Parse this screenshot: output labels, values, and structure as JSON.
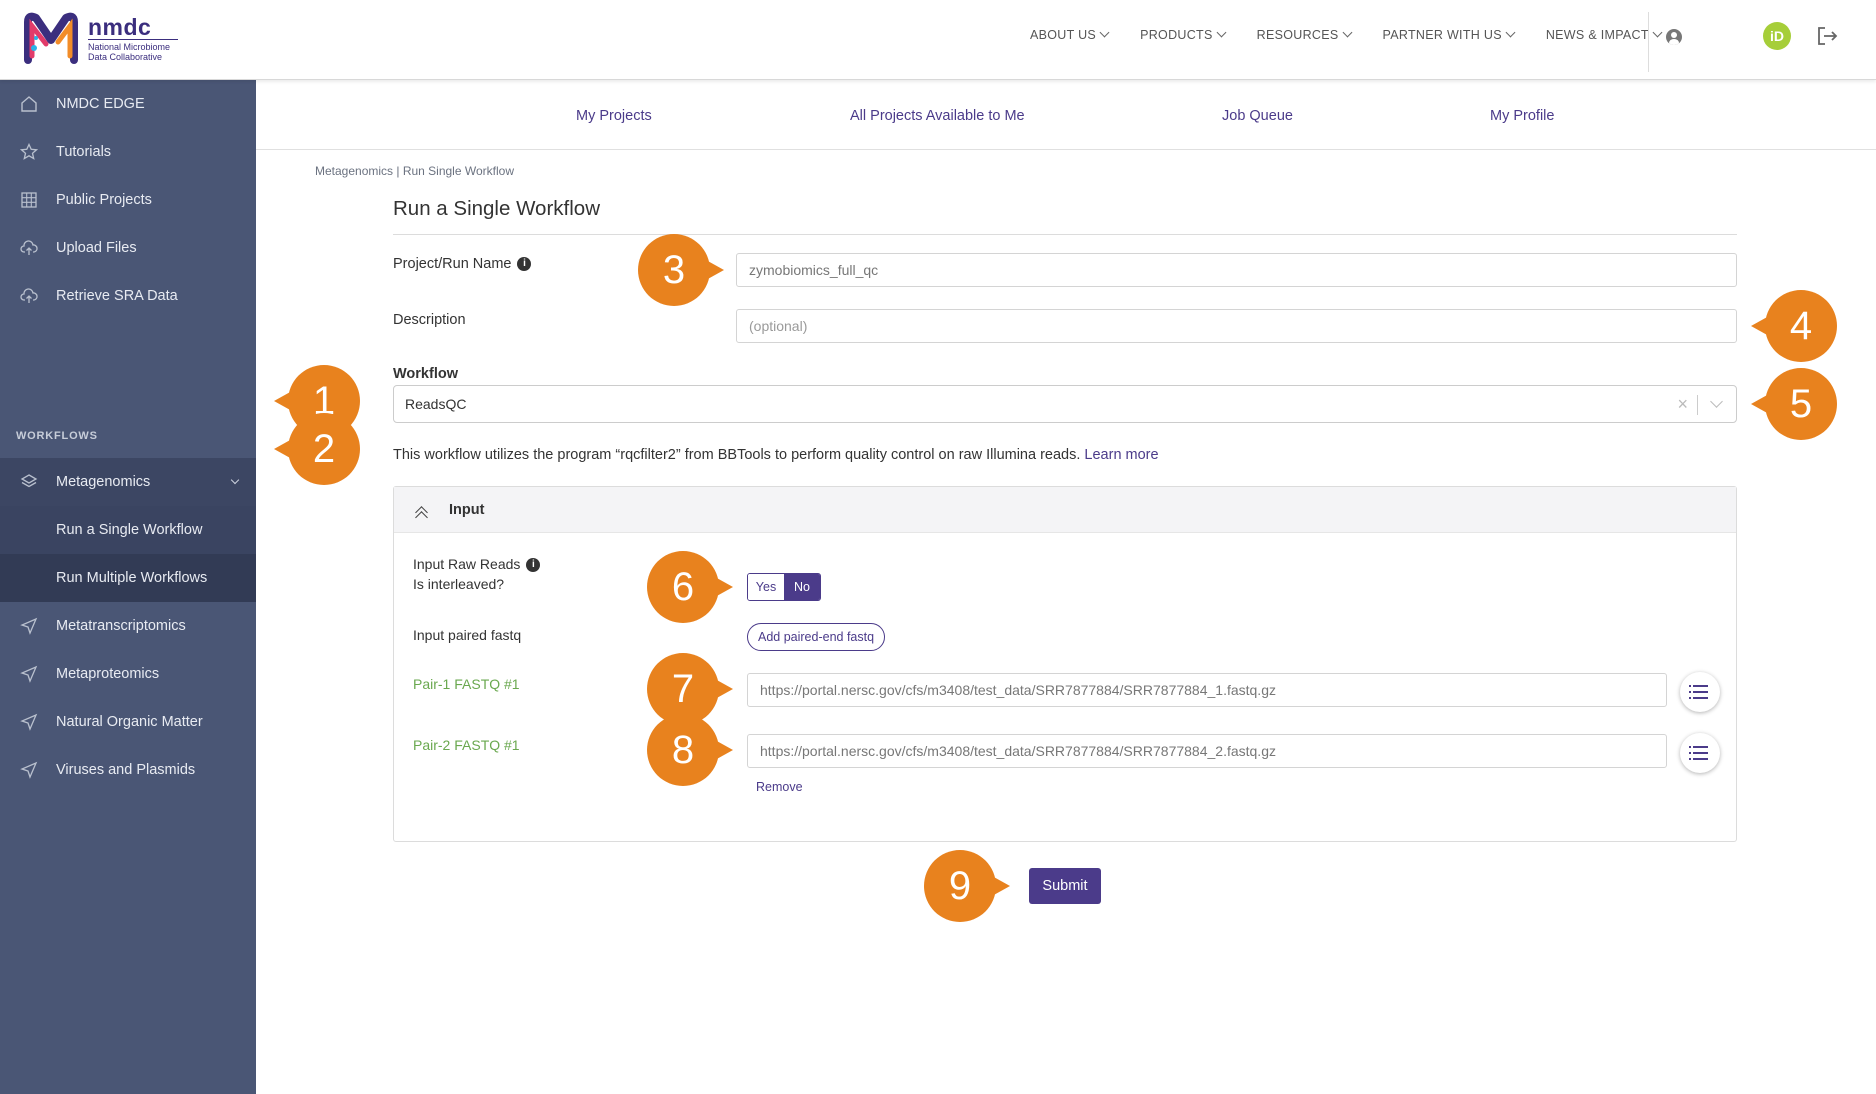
{
  "brand": {
    "title": "nmdc",
    "subtitle_line1": "National Microbiome",
    "subtitle_line2": "Data Collaborative",
    "colors": {
      "primary": "#4b3b8a",
      "accent": "#e8821e",
      "sidebar": "#4a5675",
      "orcid": "#a6ce39"
    }
  },
  "topnav": {
    "items": [
      {
        "label": "ABOUT US"
      },
      {
        "label": "PRODUCTS"
      },
      {
        "label": "RESOURCES"
      },
      {
        "label": "PARTNER WITH US"
      },
      {
        "label": "NEWS & IMPACT"
      }
    ],
    "orcid_label": "iD"
  },
  "sidebar": {
    "items": [
      {
        "label": "NMDC EDGE",
        "icon": "home-icon"
      },
      {
        "label": "Tutorials",
        "icon": "star-icon"
      },
      {
        "label": "Public Projects",
        "icon": "table-icon"
      },
      {
        "label": "Upload Files",
        "icon": "cloud-upload-icon"
      },
      {
        "label": "Retrieve SRA Data",
        "icon": "cloud-upload-icon"
      }
    ],
    "section_label": "WORKFLOWS",
    "workflows": [
      {
        "label": "Metagenomics",
        "icon": "layers-icon"
      },
      {
        "label": "Run a Single Workflow"
      },
      {
        "label": "Run Multiple Workflows"
      },
      {
        "label": "Metatranscriptomics",
        "icon": "send-icon"
      },
      {
        "label": "Metaproteomics",
        "icon": "send-icon"
      },
      {
        "label": "Natural Organic Matter",
        "icon": "send-icon"
      },
      {
        "label": "Viruses and Plasmids",
        "icon": "send-icon"
      }
    ]
  },
  "subnav": {
    "items": [
      {
        "label": "My Projects"
      },
      {
        "label": "All Projects Available to Me"
      },
      {
        "label": "Job Queue"
      },
      {
        "label": "My Profile"
      }
    ]
  },
  "breadcrumb": "Metagenomics | Run Single Workflow",
  "page_title": "Run a Single Workflow",
  "form": {
    "project_name_label": "Project/Run Name",
    "project_name_value": "zymobiomics_full_qc",
    "description_label": "Description",
    "description_placeholder": "(optional)",
    "workflow_label": "Workflow",
    "workflow_value": "ReadsQC",
    "workflow_clear": "×",
    "workflow_description": "This workflow utilizes the program “rqcfilter2” from BBTools to perform quality control on raw Illumina reads.",
    "learn_more": "Learn more",
    "input_panel_title": "Input",
    "raw_reads_label": "Input Raw Reads",
    "interleaved_label": "Is interleaved?",
    "toggle_yes": "Yes",
    "toggle_no": "No",
    "paired_fastq_label": "Input paired fastq",
    "add_paired_button": "Add paired-end fastq",
    "pair1_label": "Pair-1 FASTQ #1",
    "pair1_value": "https://portal.nersc.gov/cfs/m3408/test_data/SRR7877884/SRR7877884_1.fastq.gz",
    "pair2_label": "Pair-2 FASTQ #1",
    "pair2_value": "https://portal.nersc.gov/cfs/m3408/test_data/SRR7877884/SRR7877884_2.fastq.gz",
    "remove_label": "Remove",
    "submit_label": "Submit"
  },
  "callouts": [
    "1",
    "2",
    "3",
    "4",
    "5",
    "6",
    "7",
    "8",
    "9"
  ]
}
